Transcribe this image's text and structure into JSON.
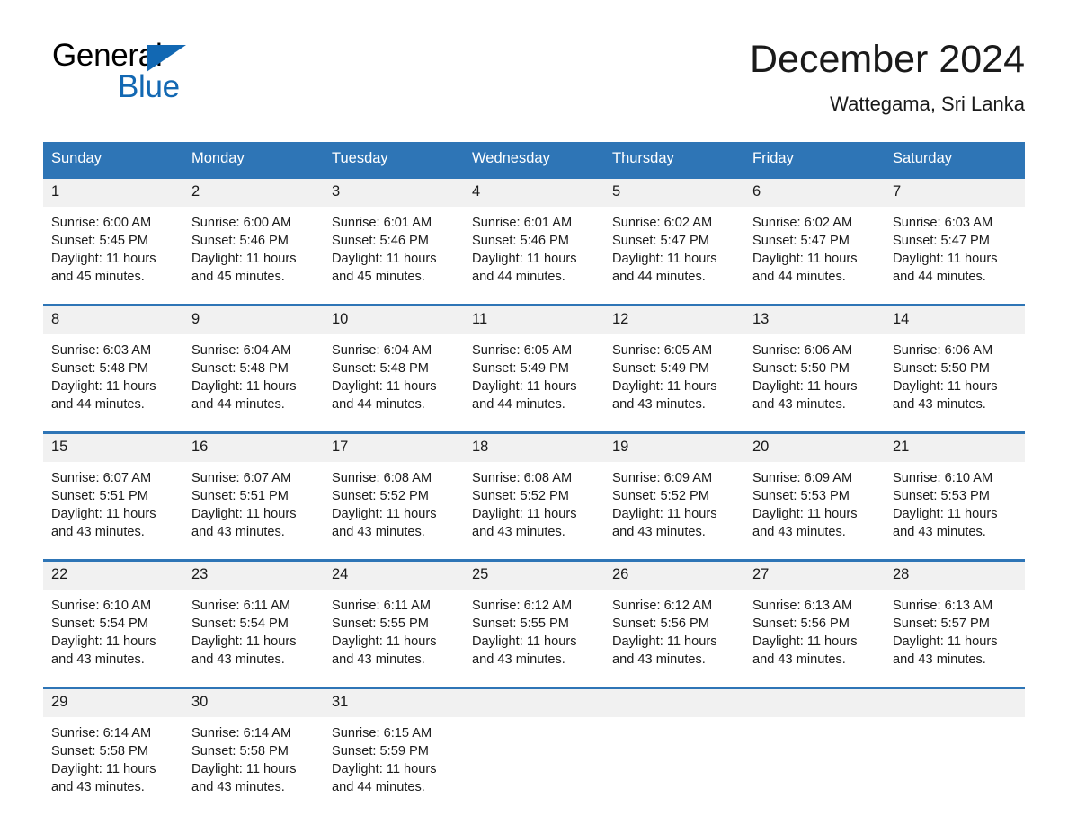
{
  "brand": {
    "name_part1": "General",
    "name_part2": "Blue"
  },
  "header": {
    "title": "December 2024",
    "subtitle": "Wattegama, Sri Lanka"
  },
  "colors": {
    "header_blue": "#2e75b6",
    "logo_blue": "#1268b3",
    "daynum_bg": "#f1f1f1"
  },
  "calendar": {
    "weekday_headers": [
      "Sunday",
      "Monday",
      "Tuesday",
      "Wednesday",
      "Thursday",
      "Friday",
      "Saturday"
    ],
    "labels": {
      "sunrise": "Sunrise:",
      "sunset": "Sunset:",
      "daylight": "Daylight:"
    },
    "weeks": [
      [
        {
          "day": "1",
          "sunrise": "Sunrise: 6:00 AM",
          "sunset": "Sunset: 5:45 PM",
          "daylight_line1": "Daylight: 11 hours",
          "daylight_line2": "and 45 minutes."
        },
        {
          "day": "2",
          "sunrise": "Sunrise: 6:00 AM",
          "sunset": "Sunset: 5:46 PM",
          "daylight_line1": "Daylight: 11 hours",
          "daylight_line2": "and 45 minutes."
        },
        {
          "day": "3",
          "sunrise": "Sunrise: 6:01 AM",
          "sunset": "Sunset: 5:46 PM",
          "daylight_line1": "Daylight: 11 hours",
          "daylight_line2": "and 45 minutes."
        },
        {
          "day": "4",
          "sunrise": "Sunrise: 6:01 AM",
          "sunset": "Sunset: 5:46 PM",
          "daylight_line1": "Daylight: 11 hours",
          "daylight_line2": "and 44 minutes."
        },
        {
          "day": "5",
          "sunrise": "Sunrise: 6:02 AM",
          "sunset": "Sunset: 5:47 PM",
          "daylight_line1": "Daylight: 11 hours",
          "daylight_line2": "and 44 minutes."
        },
        {
          "day": "6",
          "sunrise": "Sunrise: 6:02 AM",
          "sunset": "Sunset: 5:47 PM",
          "daylight_line1": "Daylight: 11 hours",
          "daylight_line2": "and 44 minutes."
        },
        {
          "day": "7",
          "sunrise": "Sunrise: 6:03 AM",
          "sunset": "Sunset: 5:47 PM",
          "daylight_line1": "Daylight: 11 hours",
          "daylight_line2": "and 44 minutes."
        }
      ],
      [
        {
          "day": "8",
          "sunrise": "Sunrise: 6:03 AM",
          "sunset": "Sunset: 5:48 PM",
          "daylight_line1": "Daylight: 11 hours",
          "daylight_line2": "and 44 minutes."
        },
        {
          "day": "9",
          "sunrise": "Sunrise: 6:04 AM",
          "sunset": "Sunset: 5:48 PM",
          "daylight_line1": "Daylight: 11 hours",
          "daylight_line2": "and 44 minutes."
        },
        {
          "day": "10",
          "sunrise": "Sunrise: 6:04 AM",
          "sunset": "Sunset: 5:48 PM",
          "daylight_line1": "Daylight: 11 hours",
          "daylight_line2": "and 44 minutes."
        },
        {
          "day": "11",
          "sunrise": "Sunrise: 6:05 AM",
          "sunset": "Sunset: 5:49 PM",
          "daylight_line1": "Daylight: 11 hours",
          "daylight_line2": "and 44 minutes."
        },
        {
          "day": "12",
          "sunrise": "Sunrise: 6:05 AM",
          "sunset": "Sunset: 5:49 PM",
          "daylight_line1": "Daylight: 11 hours",
          "daylight_line2": "and 43 minutes."
        },
        {
          "day": "13",
          "sunrise": "Sunrise: 6:06 AM",
          "sunset": "Sunset: 5:50 PM",
          "daylight_line1": "Daylight: 11 hours",
          "daylight_line2": "and 43 minutes."
        },
        {
          "day": "14",
          "sunrise": "Sunrise: 6:06 AM",
          "sunset": "Sunset: 5:50 PM",
          "daylight_line1": "Daylight: 11 hours",
          "daylight_line2": "and 43 minutes."
        }
      ],
      [
        {
          "day": "15",
          "sunrise": "Sunrise: 6:07 AM",
          "sunset": "Sunset: 5:51 PM",
          "daylight_line1": "Daylight: 11 hours",
          "daylight_line2": "and 43 minutes."
        },
        {
          "day": "16",
          "sunrise": "Sunrise: 6:07 AM",
          "sunset": "Sunset: 5:51 PM",
          "daylight_line1": "Daylight: 11 hours",
          "daylight_line2": "and 43 minutes."
        },
        {
          "day": "17",
          "sunrise": "Sunrise: 6:08 AM",
          "sunset": "Sunset: 5:52 PM",
          "daylight_line1": "Daylight: 11 hours",
          "daylight_line2": "and 43 minutes."
        },
        {
          "day": "18",
          "sunrise": "Sunrise: 6:08 AM",
          "sunset": "Sunset: 5:52 PM",
          "daylight_line1": "Daylight: 11 hours",
          "daylight_line2": "and 43 minutes."
        },
        {
          "day": "19",
          "sunrise": "Sunrise: 6:09 AM",
          "sunset": "Sunset: 5:52 PM",
          "daylight_line1": "Daylight: 11 hours",
          "daylight_line2": "and 43 minutes."
        },
        {
          "day": "20",
          "sunrise": "Sunrise: 6:09 AM",
          "sunset": "Sunset: 5:53 PM",
          "daylight_line1": "Daylight: 11 hours",
          "daylight_line2": "and 43 minutes."
        },
        {
          "day": "21",
          "sunrise": "Sunrise: 6:10 AM",
          "sunset": "Sunset: 5:53 PM",
          "daylight_line1": "Daylight: 11 hours",
          "daylight_line2": "and 43 minutes."
        }
      ],
      [
        {
          "day": "22",
          "sunrise": "Sunrise: 6:10 AM",
          "sunset": "Sunset: 5:54 PM",
          "daylight_line1": "Daylight: 11 hours",
          "daylight_line2": "and 43 minutes."
        },
        {
          "day": "23",
          "sunrise": "Sunrise: 6:11 AM",
          "sunset": "Sunset: 5:54 PM",
          "daylight_line1": "Daylight: 11 hours",
          "daylight_line2": "and 43 minutes."
        },
        {
          "day": "24",
          "sunrise": "Sunrise: 6:11 AM",
          "sunset": "Sunset: 5:55 PM",
          "daylight_line1": "Daylight: 11 hours",
          "daylight_line2": "and 43 minutes."
        },
        {
          "day": "25",
          "sunrise": "Sunrise: 6:12 AM",
          "sunset": "Sunset: 5:55 PM",
          "daylight_line1": "Daylight: 11 hours",
          "daylight_line2": "and 43 minutes."
        },
        {
          "day": "26",
          "sunrise": "Sunrise: 6:12 AM",
          "sunset": "Sunset: 5:56 PM",
          "daylight_line1": "Daylight: 11 hours",
          "daylight_line2": "and 43 minutes."
        },
        {
          "day": "27",
          "sunrise": "Sunrise: 6:13 AM",
          "sunset": "Sunset: 5:56 PM",
          "daylight_line1": "Daylight: 11 hours",
          "daylight_line2": "and 43 minutes."
        },
        {
          "day": "28",
          "sunrise": "Sunrise: 6:13 AM",
          "sunset": "Sunset: 5:57 PM",
          "daylight_line1": "Daylight: 11 hours",
          "daylight_line2": "and 43 minutes."
        }
      ],
      [
        {
          "day": "29",
          "sunrise": "Sunrise: 6:14 AM",
          "sunset": "Sunset: 5:58 PM",
          "daylight_line1": "Daylight: 11 hours",
          "daylight_line2": "and 43 minutes."
        },
        {
          "day": "30",
          "sunrise": "Sunrise: 6:14 AM",
          "sunset": "Sunset: 5:58 PM",
          "daylight_line1": "Daylight: 11 hours",
          "daylight_line2": "and 43 minutes."
        },
        {
          "day": "31",
          "sunrise": "Sunrise: 6:15 AM",
          "sunset": "Sunset: 5:59 PM",
          "daylight_line1": "Daylight: 11 hours",
          "daylight_line2": "and 44 minutes."
        },
        {
          "day": "",
          "sunrise": "",
          "sunset": "",
          "daylight_line1": "",
          "daylight_line2": ""
        },
        {
          "day": "",
          "sunrise": "",
          "sunset": "",
          "daylight_line1": "",
          "daylight_line2": ""
        },
        {
          "day": "",
          "sunrise": "",
          "sunset": "",
          "daylight_line1": "",
          "daylight_line2": ""
        },
        {
          "day": "",
          "sunrise": "",
          "sunset": "",
          "daylight_line1": "",
          "daylight_line2": ""
        }
      ]
    ]
  }
}
